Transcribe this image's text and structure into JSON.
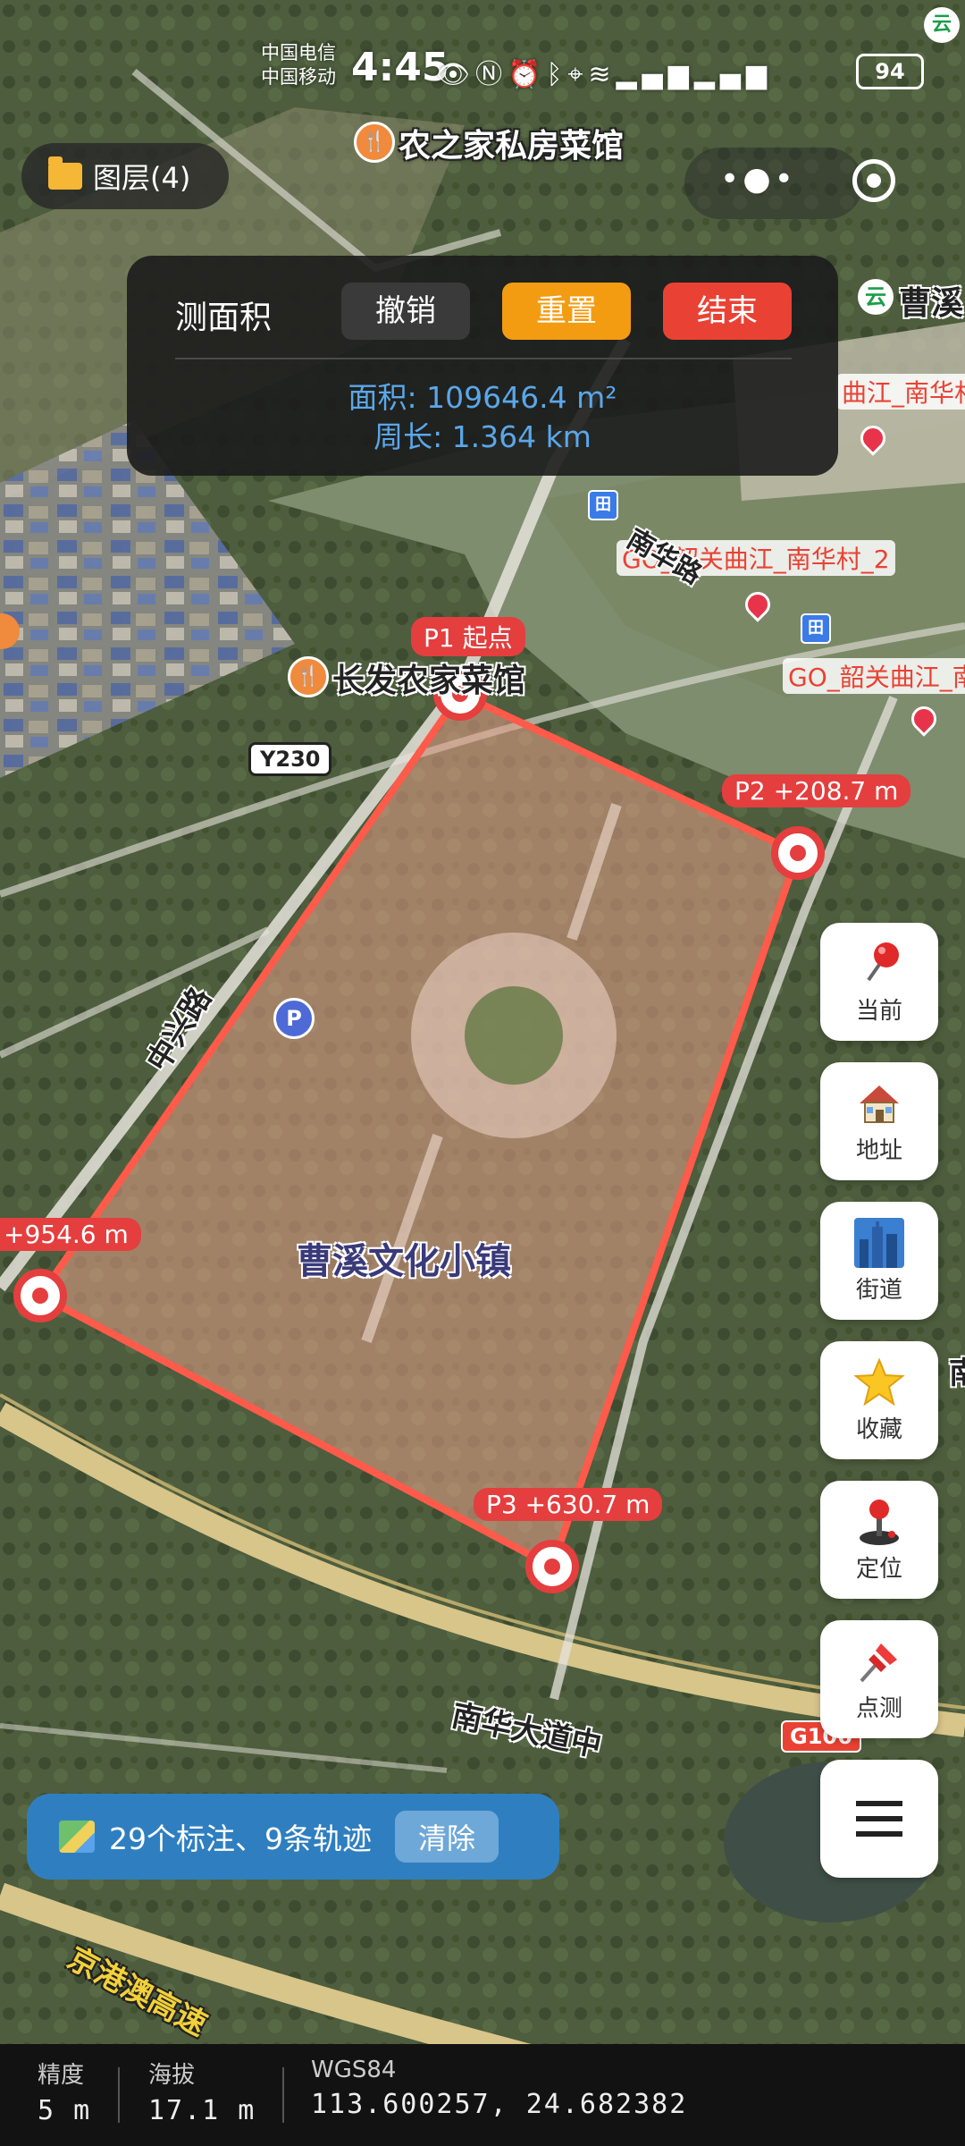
{
  "status_bar": {
    "carrier_1": "中国电信",
    "carrier_2": "中国移动",
    "time": "4:45",
    "battery": "94"
  },
  "layers_button": {
    "label": "图层(4)"
  },
  "measure_panel": {
    "title": "测面积",
    "undo_label": "撤销",
    "reset_label": "重置",
    "end_label": "结束",
    "area": "面积: 109646.4 m²",
    "perimeter": "周长: 1.364 km"
  },
  "map": {
    "poi_1": "农之家私房菜馆",
    "poi_2": "长发农家菜馆",
    "poi_3": "曹溪",
    "area_name": "曹溪文化小镇",
    "go_label_1": "曲江_南华村",
    "go_label_2": "GO_韶关曲江_南华村_2",
    "go_label_3": "GO_韶关曲江_南",
    "road_1": "中兴路",
    "road_2": "南华大道中",
    "road_3": "京港澳高速",
    "road_4": "南",
    "road_shield_y230": "Y230",
    "road_shield_g106": "G106",
    "parking": "P",
    "bus_stop": "田"
  },
  "vertices": {
    "p1": "P1 起点",
    "p2": "P2 +208.7 m",
    "p3": "P3 +630.7 m",
    "p4": "+954.6 m"
  },
  "side_buttons": [
    {
      "label": "当前",
      "icon": "pin-icon"
    },
    {
      "label": "地址",
      "icon": "house-icon"
    },
    {
      "label": "街道",
      "icon": "city-icon"
    },
    {
      "label": "收藏",
      "icon": "star-icon"
    },
    {
      "label": "定位",
      "icon": "joystick-icon"
    },
    {
      "label": "点测",
      "icon": "pushpin-icon"
    },
    {
      "label": "",
      "icon": "menu-icon"
    }
  ],
  "summary": {
    "text": "29个标注、9条轨迹",
    "clear_label": "清除"
  },
  "bottom_bar": {
    "accuracy_key": "精度",
    "accuracy_val": "5 m",
    "altitude_key": "海拔",
    "altitude_val": "17.1 m",
    "datum_key": "WGS84",
    "coords_val": "113.600257, 24.682382"
  },
  "colors": {
    "accent_orange": "#f39c12",
    "accent_red": "#e94234",
    "measure_text": "#5aa7ea",
    "polygon_fill": "#e8a08a",
    "summary_bg": "#2f7fc0"
  }
}
